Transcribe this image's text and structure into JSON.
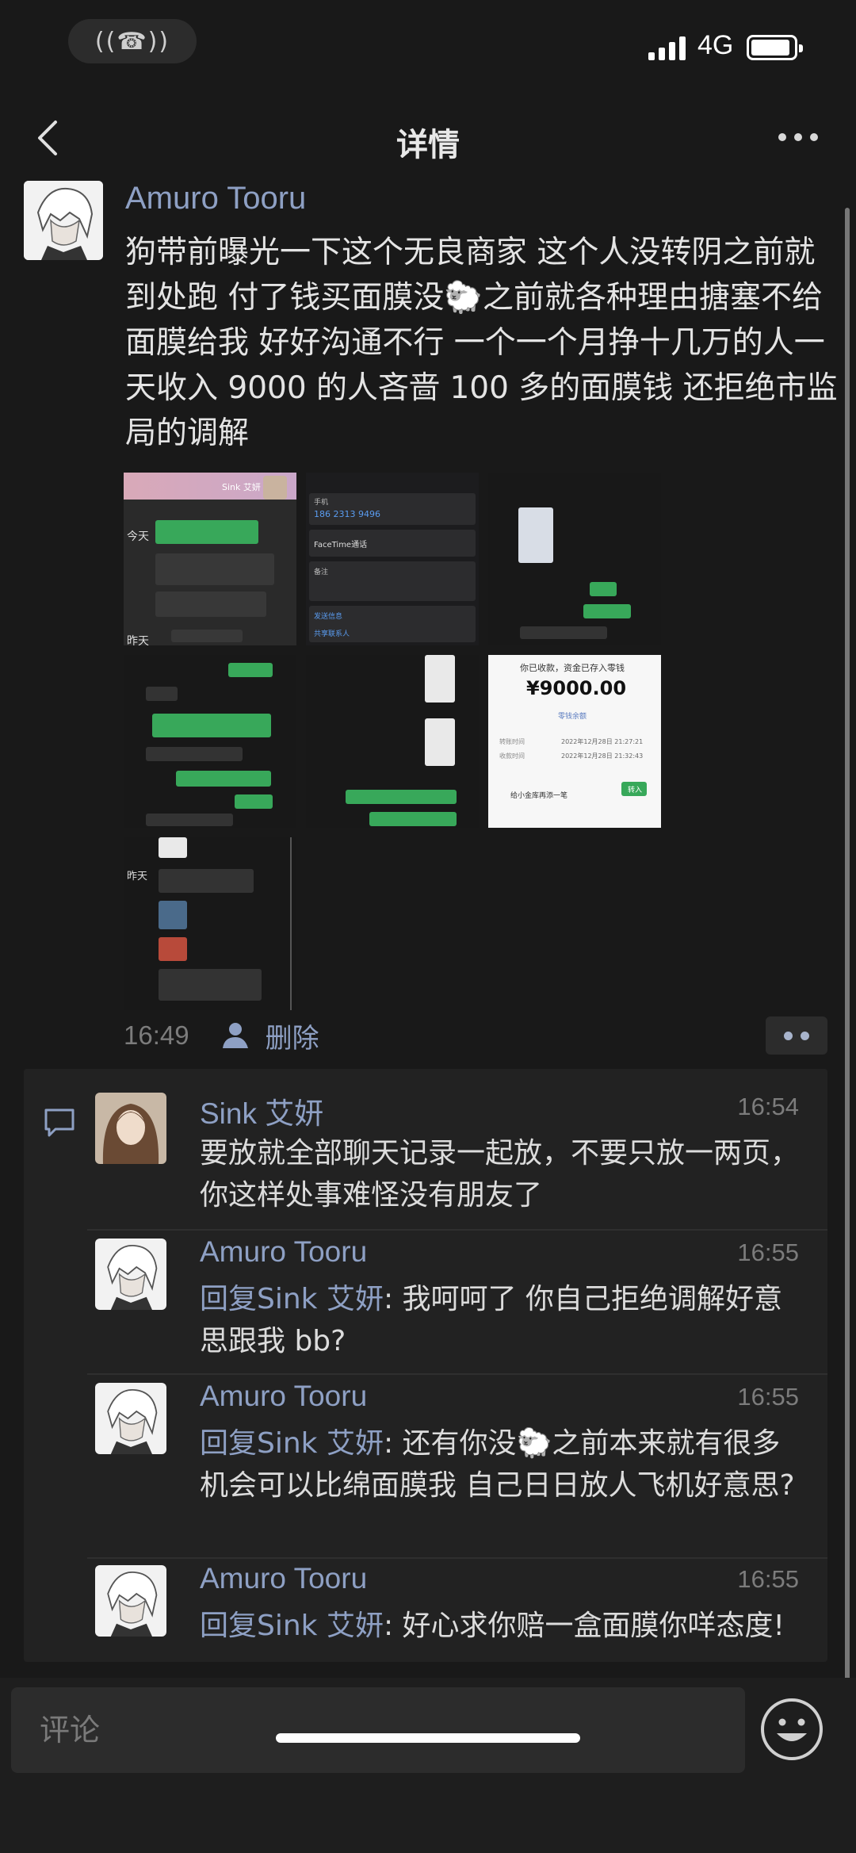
{
  "status_bar": {
    "network": "4G",
    "call_indicator": "((☎))"
  },
  "nav": {
    "title": "详情",
    "back_icon": "chevron-left-icon",
    "more_icon": "more-dots-icon"
  },
  "post": {
    "author": "Amuro Tooru",
    "text": "狗带前曝光一下这个无良商家 这个人没转阴之前就到处跑 付了钱买面膜没🐑之前就各种理由搪塞不给面膜给我 好好沟通不行 一个一个月挣十几万的人一天收入 9000 的人吝啬 100 多的面膜钱 还拒绝市监局的调解",
    "time": "16:49",
    "delete_label": "删除",
    "images": {
      "img1": {
        "name": "Sink 艾妍",
        "labels": [
          "今天",
          "昨天"
        ]
      },
      "img2": {
        "phone_label": "手机",
        "phone": "186 2313 9496",
        "facetime": "FaceTime通话",
        "note": "备注",
        "send": "发送信息",
        "share": "共享联系人"
      },
      "img6": {
        "header": "你已收款，资金已存入零钱",
        "amount": "¥9000.00",
        "balance": "零钱余额",
        "row1_label": "转账时间",
        "row1_value": "2022年12月28日 21:27:21",
        "row2_label": "收款时间",
        "row2_value": "2022年12月28日 21:32:43",
        "promo": "给小金库再添一笔",
        "promo_btn": "转入"
      },
      "img7": {
        "label": "昨天"
      }
    }
  },
  "comments": [
    {
      "name": "Sink 艾妍",
      "time": "16:54",
      "reply_to": "",
      "text": "要放就全部聊天记录一起放，不要只放一两页，你这样处事难怪没有朋友了"
    },
    {
      "name": "Amuro Tooru",
      "time": "16:55",
      "reply_to": "回复Sink 艾妍",
      "text": ": 我呵呵了 你自己拒绝调解好意思跟我 bb?"
    },
    {
      "name": "Amuro Tooru",
      "time": "16:55",
      "reply_to": "回复Sink 艾妍",
      "text": ": 还有你没🐑之前本来就有很多机会可以比绵面膜我 自己日日放人飞机好意思?"
    },
    {
      "name": "Amuro Tooru",
      "time": "16:55",
      "reply_to": "回复Sink 艾妍",
      "text": ": 好心求你赔一盒面膜你咩态度!"
    }
  ],
  "input": {
    "placeholder": "评论",
    "emoji_icon": "emoji-icon"
  },
  "colors": {
    "background": "#191919",
    "link": "#8ea0c4",
    "text": "#e4e4e4",
    "comment_bg": "#222222"
  }
}
